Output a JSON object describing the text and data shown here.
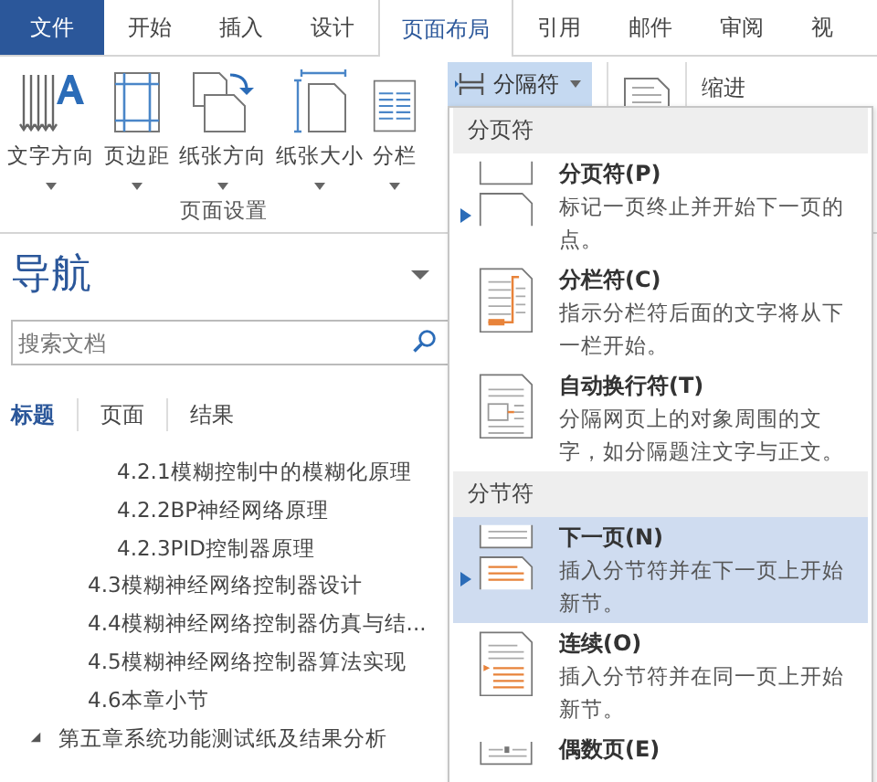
{
  "tabs": [
    {
      "label": "文件",
      "kind": "file",
      "selected": false
    },
    {
      "label": "开始",
      "kind": "tab",
      "selected": false
    },
    {
      "label": "插入",
      "kind": "tab",
      "selected": false
    },
    {
      "label": "设计",
      "kind": "tab",
      "selected": false
    },
    {
      "label": "页面布局",
      "kind": "tab",
      "selected": true
    },
    {
      "label": "引用",
      "kind": "tab",
      "selected": false
    },
    {
      "label": "邮件",
      "kind": "tab",
      "selected": false
    },
    {
      "label": "审阅",
      "kind": "tab",
      "selected": false
    },
    {
      "label": "视",
      "kind": "tab",
      "selected": false
    }
  ],
  "ribbon": {
    "buttons": [
      {
        "label": "文字方向"
      },
      {
        "label": "页边距"
      },
      {
        "label": "纸张方向"
      },
      {
        "label": "纸张大小"
      },
      {
        "label": "分栏"
      }
    ],
    "group_label": "页面设置",
    "breaks_button": {
      "label": "分隔符",
      "open": true
    },
    "indent_label": "缩进"
  },
  "navigation": {
    "title": "导航",
    "search": {
      "placeholder": "搜索文档"
    },
    "tabs": [
      {
        "label": "标题",
        "selected": true
      },
      {
        "label": "页面",
        "selected": false
      },
      {
        "label": "结果",
        "selected": false
      }
    ],
    "outline": [
      {
        "children": [
          {
            "children": [
              {
                "label": "4.2.1模糊控制中的模糊化原理"
              },
              {
                "label": "4.2.2BP神经网络原理"
              },
              {
                "label": "4.2.3PID控制器原理"
              }
            ]
          },
          {
            "label": "4.3模糊神经网络控制器设计"
          },
          {
            "label": "4.4模糊神经网络控制器仿真与结..."
          },
          {
            "label": "4.5模糊神经网络控制器算法实现"
          },
          {
            "label": "4.6本章小节"
          }
        ]
      },
      {
        "label": "第五章系统功能测试纸及结果分析",
        "expanded": true
      }
    ]
  },
  "menu": {
    "sections": [
      {
        "header": "分页符",
        "items": [
          {
            "title": "分页符(P)",
            "description": "标记一页终止并开始下一页的点。",
            "pointer": true,
            "selected": false
          },
          {
            "title": "分栏符(C)",
            "description": "指示分栏符后面的文字将从下一栏开始。",
            "pointer": false,
            "selected": false
          },
          {
            "title": "自动换行符(T)",
            "description": "分隔网页上的对象周围的文字，如分隔题注文字与正文。",
            "pointer": false,
            "selected": false
          }
        ]
      },
      {
        "header": "分节符",
        "items": [
          {
            "title": "下一页(N)",
            "description": "插入分节符并在下一页上开始新节。",
            "pointer": true,
            "selected": true
          },
          {
            "title": "连续(O)",
            "description": "插入分节符并在同一页上开始新节。",
            "pointer": false,
            "selected": false
          },
          {
            "title": "偶数页(E)",
            "pointer": false,
            "selected": false
          }
        ]
      }
    ]
  }
}
